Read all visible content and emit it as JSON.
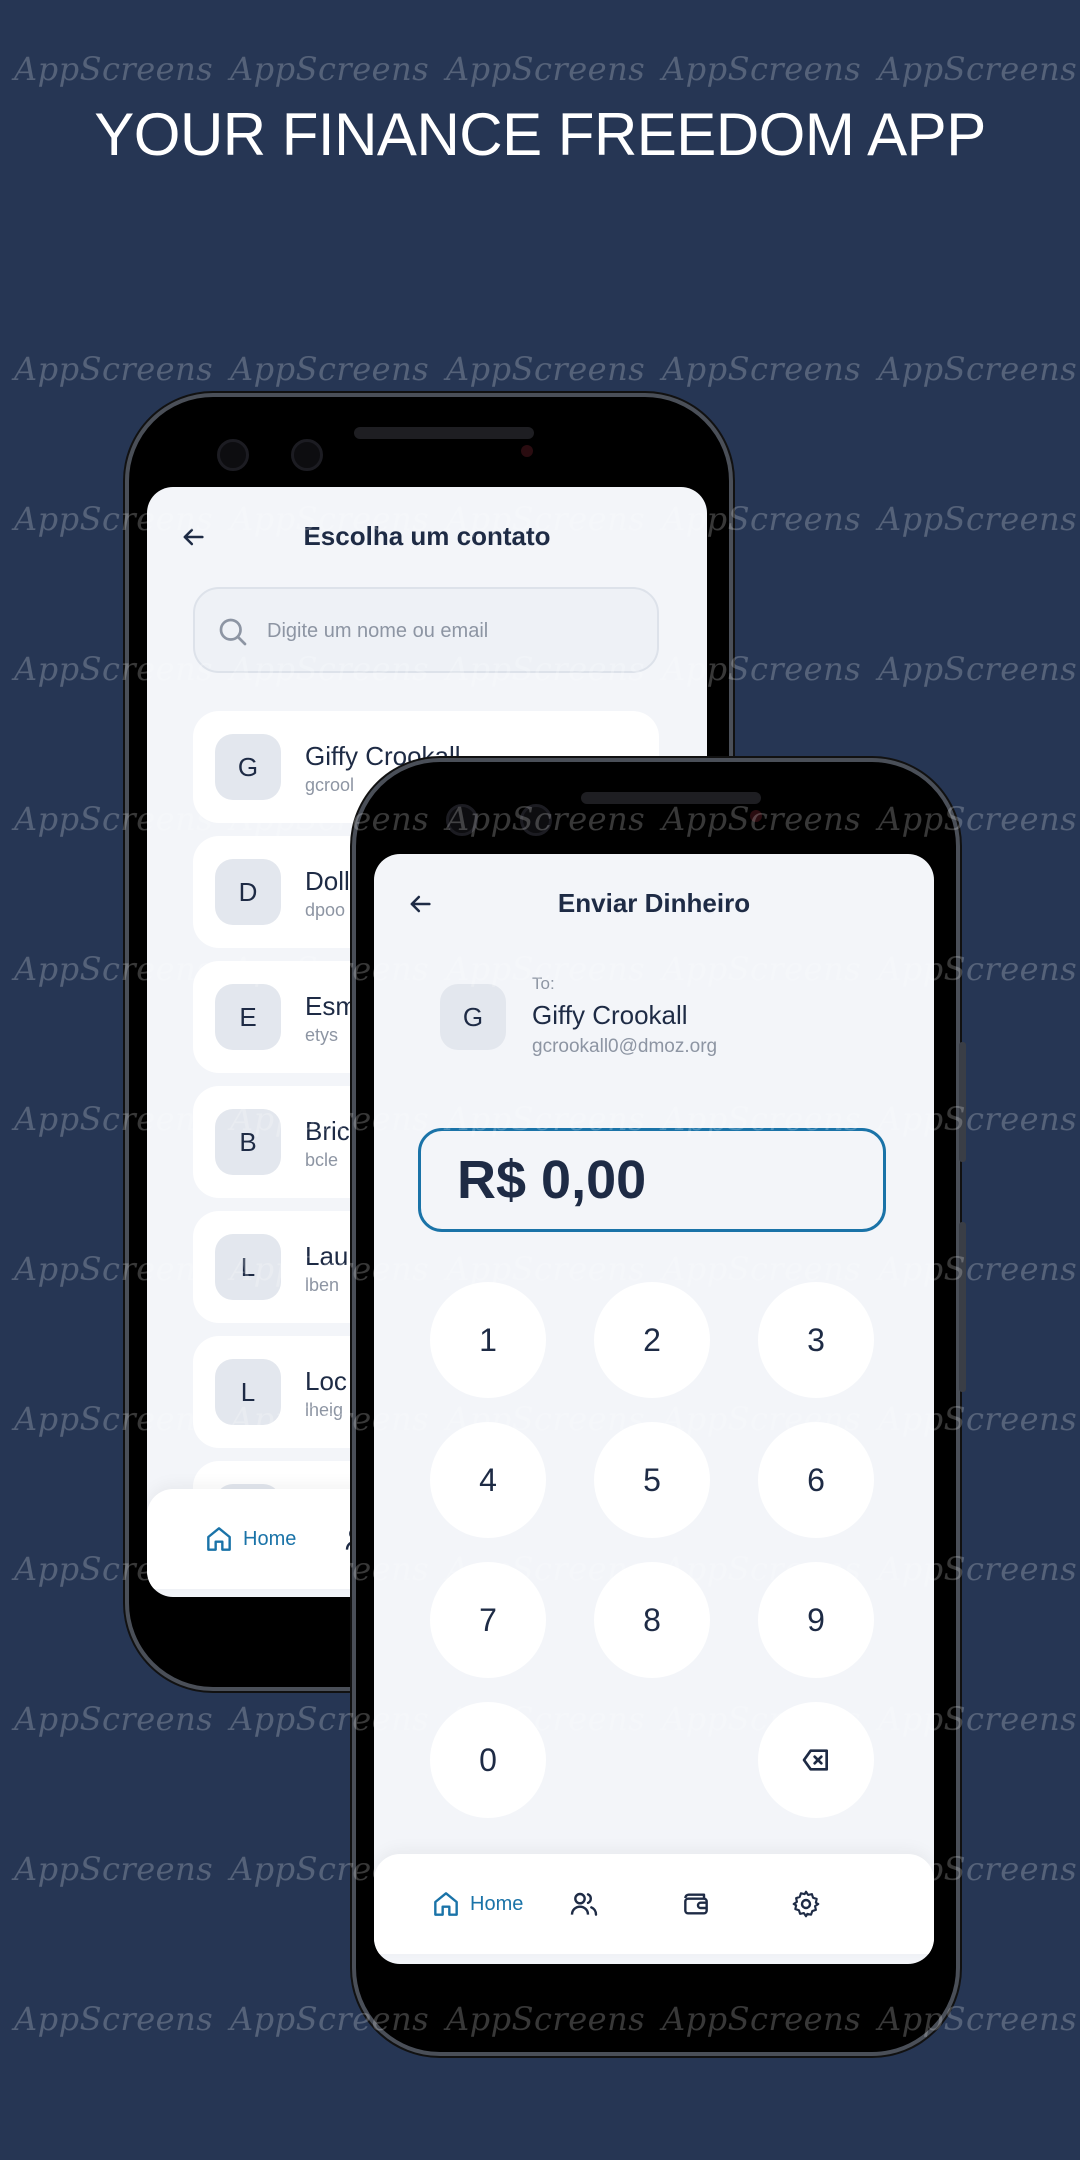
{
  "headline": "YOUR FINANCE FREEDOM APP",
  "watermark": "AppScreens",
  "colors": {
    "background": "#263654",
    "accent": "#1a73a8",
    "text_dark": "#1e2b45",
    "text_muted": "#8d95a3"
  },
  "contacts_screen": {
    "title": "Escolha um contato",
    "back_icon": "arrow-left-icon",
    "search": {
      "placeholder": "Digite um nome ou email",
      "value": ""
    },
    "contacts": [
      {
        "initial": "G",
        "name": "Giffy Crookall",
        "email": "gcrool"
      },
      {
        "initial": "D",
        "name": "Doll",
        "email": "dpoo"
      },
      {
        "initial": "E",
        "name": "Esm",
        "email": "etys"
      },
      {
        "initial": "B",
        "name": "Bric",
        "email": "bcle"
      },
      {
        "initial": "L",
        "name": "Lau",
        "email": "lben"
      },
      {
        "initial": "L",
        "name": "Loc",
        "email": "lheig"
      }
    ],
    "nav": {
      "home_label": "Home"
    }
  },
  "send_screen": {
    "title": "Enviar Dinheiro",
    "back_icon": "arrow-left-icon",
    "recipient": {
      "to_label": "To:",
      "initial": "G",
      "name": "Giffy Crookall",
      "email": "gcrookall0@dmoz.org"
    },
    "amount": "R$ 0,00",
    "keypad": [
      "1",
      "2",
      "3",
      "4",
      "5",
      "6",
      "7",
      "8",
      "9",
      "0"
    ],
    "backspace_icon": "backspace-icon",
    "nav": {
      "home_label": "Home",
      "icons": [
        "home-icon",
        "users-icon",
        "wallet-icon",
        "gear-icon"
      ],
      "active": "home"
    }
  }
}
